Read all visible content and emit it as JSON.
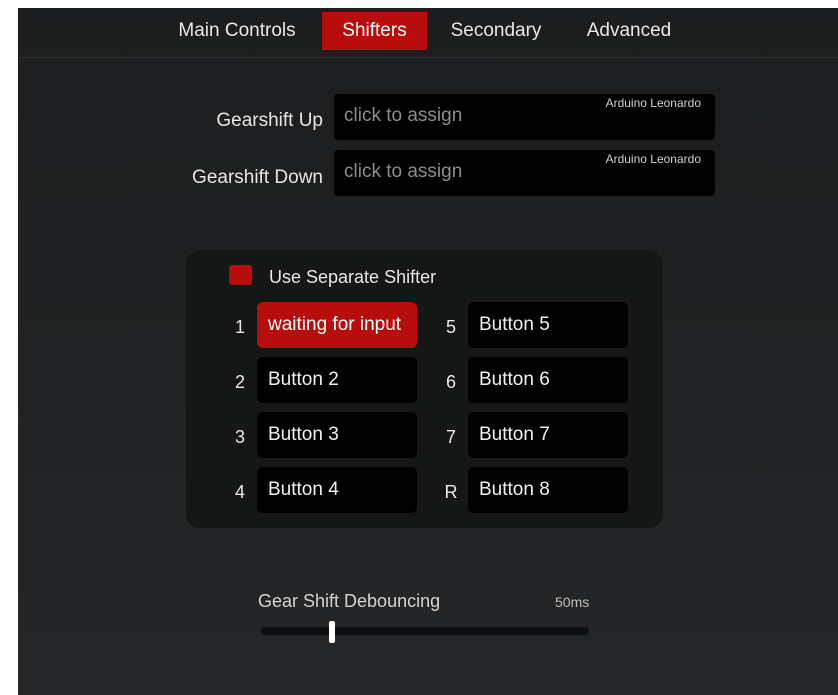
{
  "tabs": [
    {
      "label": "Main Controls",
      "active": false
    },
    {
      "label": "Shifters",
      "active": true
    },
    {
      "label": "Secondary",
      "active": false
    },
    {
      "label": "Advanced",
      "active": false
    }
  ],
  "gearshift_up": {
    "label": "Gearshift Up",
    "value": "click to assign",
    "device": "Arduino Leonardo"
  },
  "gearshift_down": {
    "label": "Gearshift Down",
    "value": "click to assign",
    "device": "Arduino Leonardo"
  },
  "separate_shifter": {
    "label": "Use Separate Shifter",
    "checked": true,
    "gears": [
      {
        "gear": "1",
        "button": "waiting for input",
        "waiting": true
      },
      {
        "gear": "2",
        "button": "Button 2"
      },
      {
        "gear": "3",
        "button": "Button 3"
      },
      {
        "gear": "4",
        "button": "Button 4"
      },
      {
        "gear": "5",
        "button": "Button 5"
      },
      {
        "gear": "6",
        "button": "Button 6"
      },
      {
        "gear": "7",
        "button": "Button 7"
      },
      {
        "gear": "R",
        "button": "Button 8"
      }
    ]
  },
  "debounce": {
    "label": "Gear Shift Debouncing",
    "value_text": "50ms",
    "fraction": 0.21
  },
  "colors": {
    "accent": "#b80d0d",
    "background": "#1f2122",
    "field": "#000000"
  }
}
